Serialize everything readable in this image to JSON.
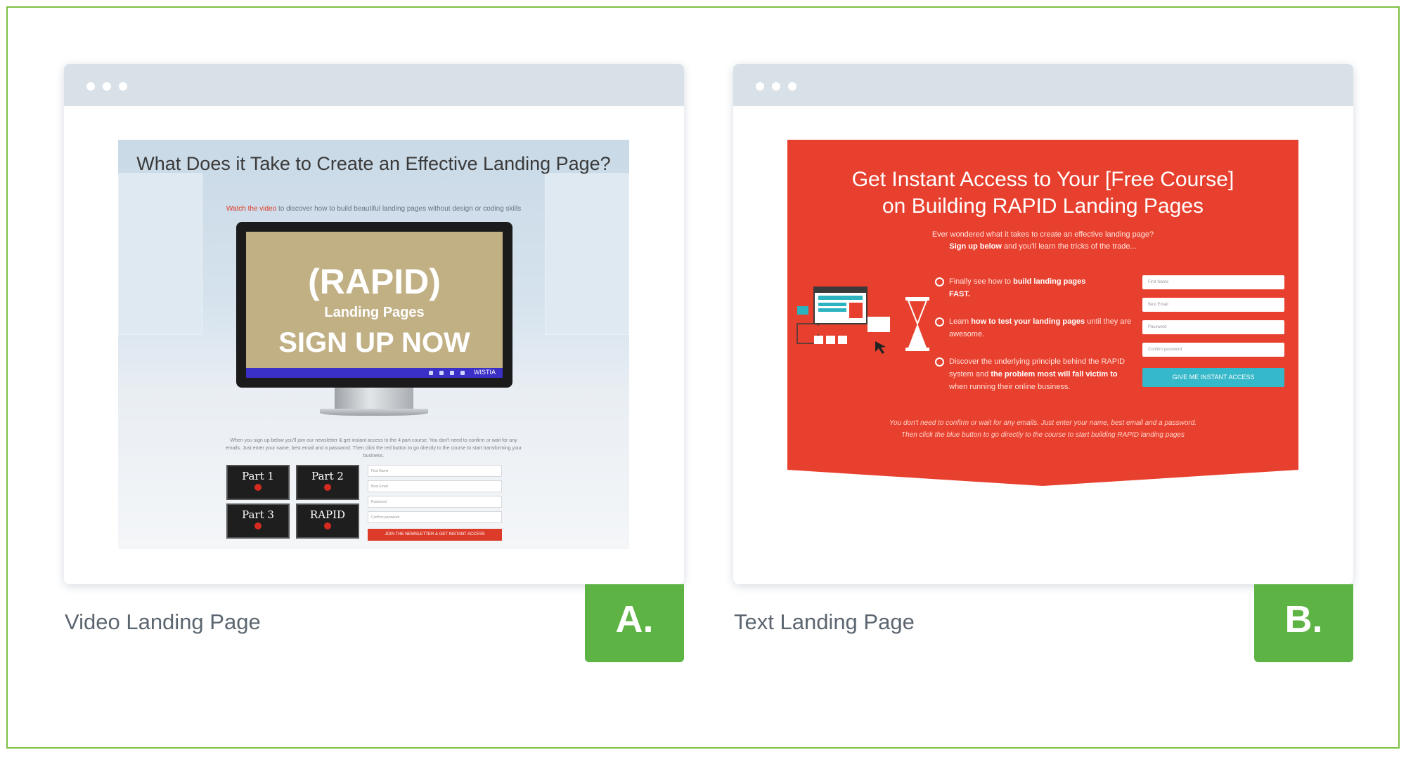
{
  "colors": {
    "frame_border": "#7dc142",
    "badge_green": "#5db444",
    "titlebar": "#d9e1e8",
    "text_page_red": "#e8402e",
    "cta_cyan": "#35b8c9",
    "cta_red": "#dc3b29"
  },
  "cards": [
    {
      "caption": "Video Landing Page",
      "badge": "A.",
      "preview": {
        "headline": "What Does it Take to Create an Effective Landing Page?",
        "sub_highlight": "Watch the video",
        "sub_text": " to discover how to build beautiful landing pages without design or coding skills",
        "screen_title": "(RAPID)",
        "screen_subtitle": "Landing Pages",
        "screen_cta": "SIGN UP NOW",
        "player_brand": "WISTIA",
        "body_text": "When you sign up below you'll join our newsletter & get instant access to the 4 part course. You don't need to confirm or wait for any emails. Just enter your name, best email and a password. Then click the red button to go directly to the course to start transforming your business.",
        "parts": [
          {
            "title": "Part 1"
          },
          {
            "title": "Part 2"
          },
          {
            "title": "Part 3"
          },
          {
            "title": "RAPID"
          }
        ],
        "fields": [
          "First Name",
          "Best Email",
          "Password",
          "Confirm password"
        ],
        "button": "JOIN THE NEWSLETTER & GET INSTANT ACCESS"
      }
    },
    {
      "caption": "Text Landing Page",
      "badge": "B.",
      "preview": {
        "headline_line1": "Get Instant Access to Your [Free Course]",
        "headline_line2": "on Building RAPID Landing Pages",
        "sub_line1": "Ever wondered what it takes to create an effective landing page?",
        "sub_bold": "Sign up below",
        "sub_line2": " and you'll learn the tricks of the trade...",
        "bullets": [
          {
            "pre": "Finally see how to ",
            "bold": "build landing pages",
            "post": "",
            "bold2": "FAST.",
            "post2": ""
          },
          {
            "pre": "Learn ",
            "bold": "how to test your landing pages",
            "post": " until they are awesome.",
            "bold2": "",
            "post2": ""
          },
          {
            "pre": "Discover the underlying principle behind the RAPID system and ",
            "bold": "the problem most will fall victim to",
            "post": " when running their online business.",
            "bold2": "",
            "post2": ""
          }
        ],
        "fields": [
          "First Name",
          "Best Email",
          "Password",
          "Confirm password"
        ],
        "button": "GIVE ME INSTANT ACCESS",
        "footer_line1": "You don't need to confirm or wait for any emails. Just enter your name, best email and a password.",
        "footer_line2": "Then click the blue button to go directly to the course to start building RAPID landing pages"
      }
    }
  ]
}
